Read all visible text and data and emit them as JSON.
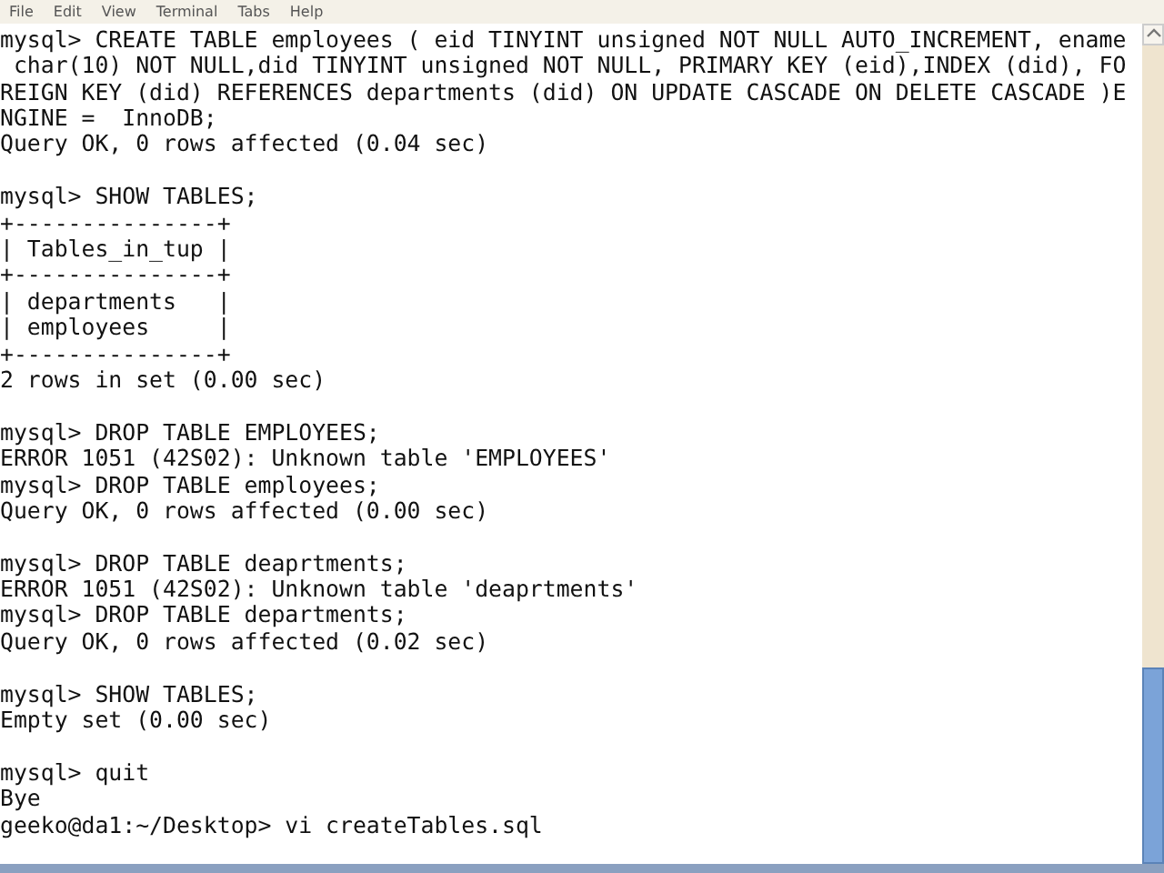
{
  "menu": [
    "File",
    "Edit",
    "View",
    "Terminal",
    "Tabs",
    "Help"
  ],
  "blocks": [
    [
      "mysql> CREATE TABLE employees ( eid TINYINT unsigned NOT NULL AUTO_INCREMENT, ename",
      " char(10) NOT NULL,did TINYINT unsigned NOT NULL, PRIMARY KEY (eid),INDEX (did), FO",
      "REIGN KEY (did) REFERENCES departments (did) ON UPDATE CASCADE ON DELETE CASCADE )E",
      "NGINE =  InnoDB;",
      "Query OK, 0 rows affected (0.04 sec)"
    ],
    [
      "mysql> SHOW TABLES;",
      "+---------------+",
      "| Tables_in_tup |",
      "+---------------+",
      "| departments   |",
      "| employees     |",
      "+---------------+",
      "2 rows in set (0.00 sec)"
    ],
    [
      "mysql> DROP TABLE EMPLOYEES;",
      "ERROR 1051 (42S02): Unknown table 'EMPLOYEES'",
      "mysql> DROP TABLE employees;",
      "Query OK, 0 rows affected (0.00 sec)"
    ],
    [
      "mysql> DROP TABLE deaprtments;",
      "ERROR 1051 (42S02): Unknown table 'deaprtments'",
      "mysql> DROP TABLE departments;",
      "Query OK, 0 rows affected (0.02 sec)"
    ],
    [
      "mysql> SHOW TABLES;",
      "Empty set (0.00 sec)"
    ],
    [
      "mysql> quit",
      "Bye",
      "geeko@da1:~/Desktop> vi createTables.sql"
    ]
  ]
}
